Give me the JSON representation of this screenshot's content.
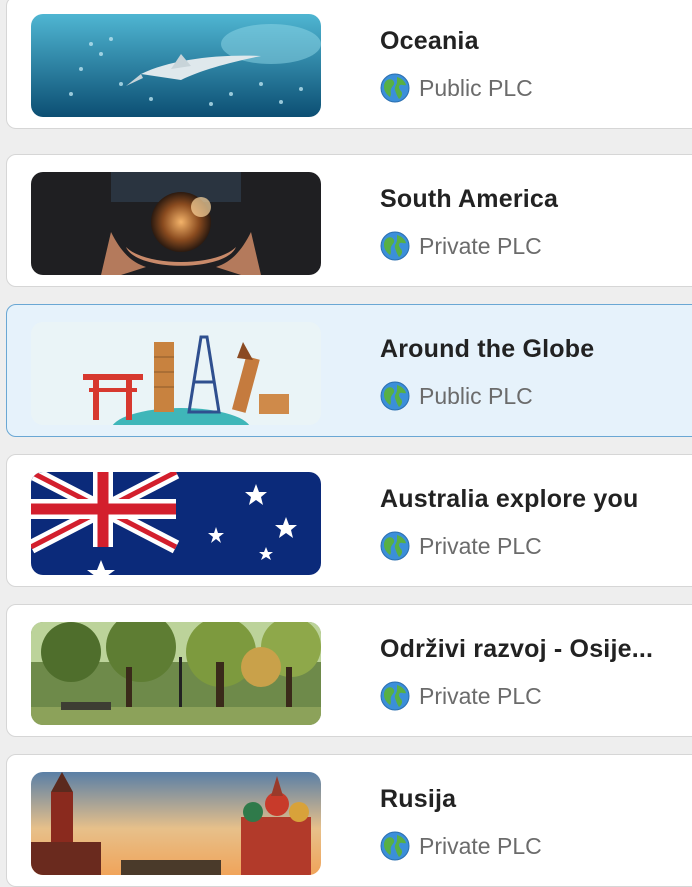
{
  "colors": {
    "card_bg": "#ffffff",
    "card_border": "#d6d6d6",
    "selected_bg": "#e6f2fb",
    "selected_border": "#6aa7d4",
    "title_text": "#222222",
    "meta_text": "#6b6b6b"
  },
  "items": [
    {
      "title": "Oceania",
      "visibility": "Public PLC",
      "image": "ocean-shark-photo",
      "icon": "globe-icon",
      "selected": false
    },
    {
      "title": "South America",
      "visibility": "Private PLC",
      "image": "hands-holding-earth-photo",
      "icon": "globe-icon",
      "selected": false
    },
    {
      "title": "Around the Globe",
      "visibility": "Public PLC",
      "image": "world-landmarks-illustration",
      "icon": "globe-icon",
      "selected": true
    },
    {
      "title": "Australia explore you",
      "visibility": "Private PLC",
      "image": "australian-flag",
      "icon": "globe-icon",
      "selected": false
    },
    {
      "title": "Održivi razvoj - Osije...",
      "visibility": "Private PLC",
      "image": "park-trees-photo",
      "icon": "globe-icon",
      "selected": false
    },
    {
      "title": "Rusija",
      "visibility": "Private PLC",
      "image": "moscow-red-square-photo",
      "icon": "globe-icon",
      "selected": false
    }
  ]
}
